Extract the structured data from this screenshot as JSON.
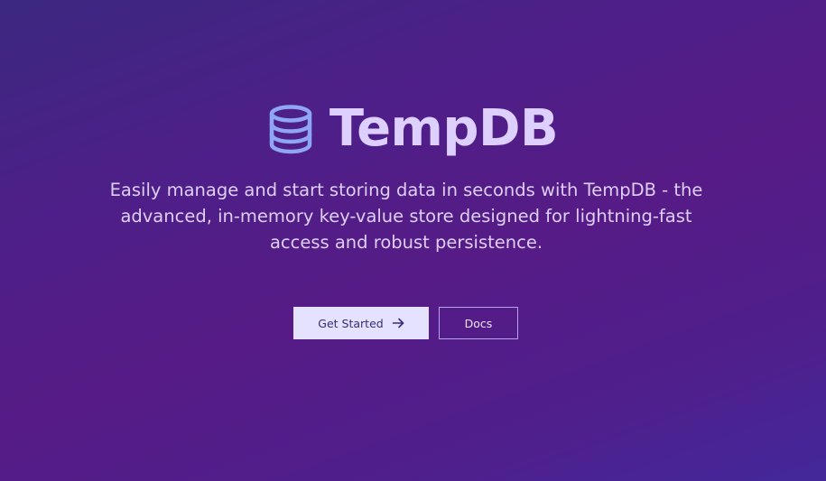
{
  "brand": {
    "title": "TempDB",
    "icon": "database-icon"
  },
  "hero": {
    "subtitle": "Easily manage and start storing data in seconds with TempDB - the advanced, in-memory key-value store designed for lightning-fast access and robust persistence."
  },
  "actions": {
    "get_started_label": "Get Started",
    "get_started_icon": "arrow-right-icon",
    "docs_label": "Docs"
  },
  "colors": {
    "background_start": "#3b2880",
    "background_mid": "#561b86",
    "background_end": "#43289a",
    "title": "#ddd0ff",
    "icon_stroke": "#8fa6f5",
    "primary_button_bg": "#e4e2ff",
    "primary_button_text": "#3a2a78",
    "secondary_button_border": "#b3a6ee"
  }
}
